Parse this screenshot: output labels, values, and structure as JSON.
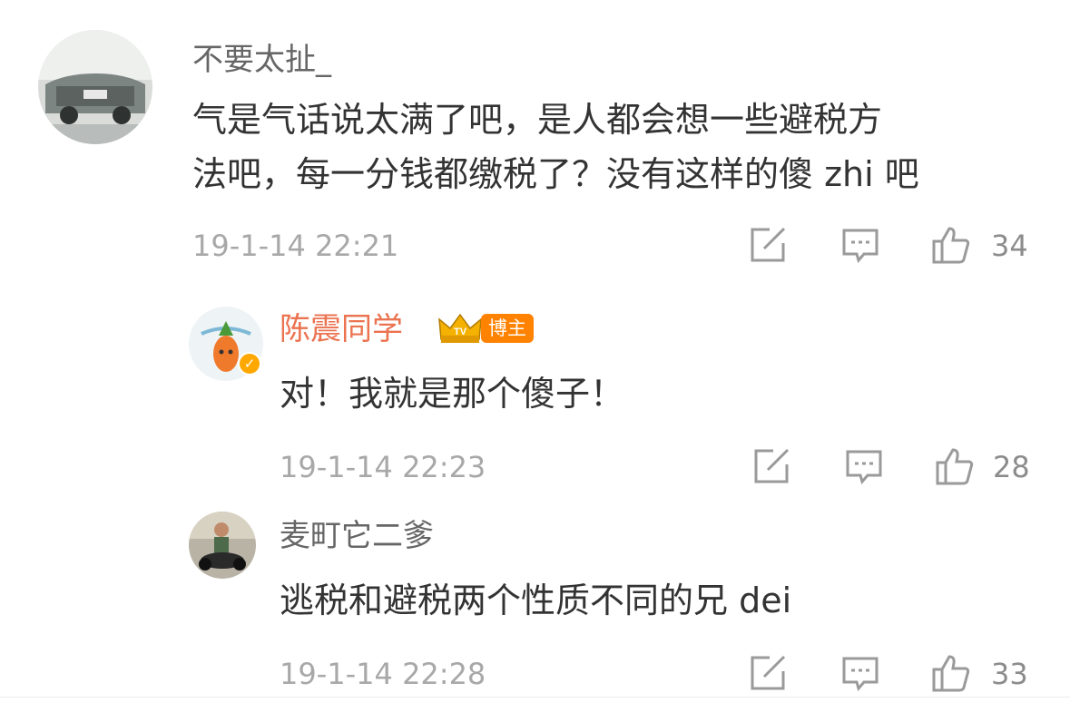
{
  "comments": [
    {
      "username": "不要太扯_",
      "text_lines": [
        "气是气话说太满了吧，是人都会想一些避税方",
        "法吧，每一分钱都缴税了？没有这样的傻 zhi 吧"
      ],
      "time": "19-1-14 22:21",
      "likes": "34"
    },
    {
      "username": "陈震同学",
      "badge": "博主",
      "text_lines": [
        "对！我就是那个傻子！"
      ],
      "time": "19-1-14 22:23",
      "likes": "28"
    },
    {
      "username": "麦町它二爹",
      "text_lines": [
        "逃税和避税两个性质不同的兄 dei"
      ],
      "time": "19-1-14 22:28",
      "likes": "33"
    }
  ],
  "icons": {
    "share": "share-icon",
    "comment": "comment-icon",
    "like": "like-icon",
    "verified": "verified-icon",
    "crown": "crown-tv-icon"
  },
  "colors": {
    "username": "#666666",
    "blogger_name": "#eb7350",
    "text": "#333333",
    "meta": "#a8a8a8",
    "badge": "#ff8200"
  }
}
